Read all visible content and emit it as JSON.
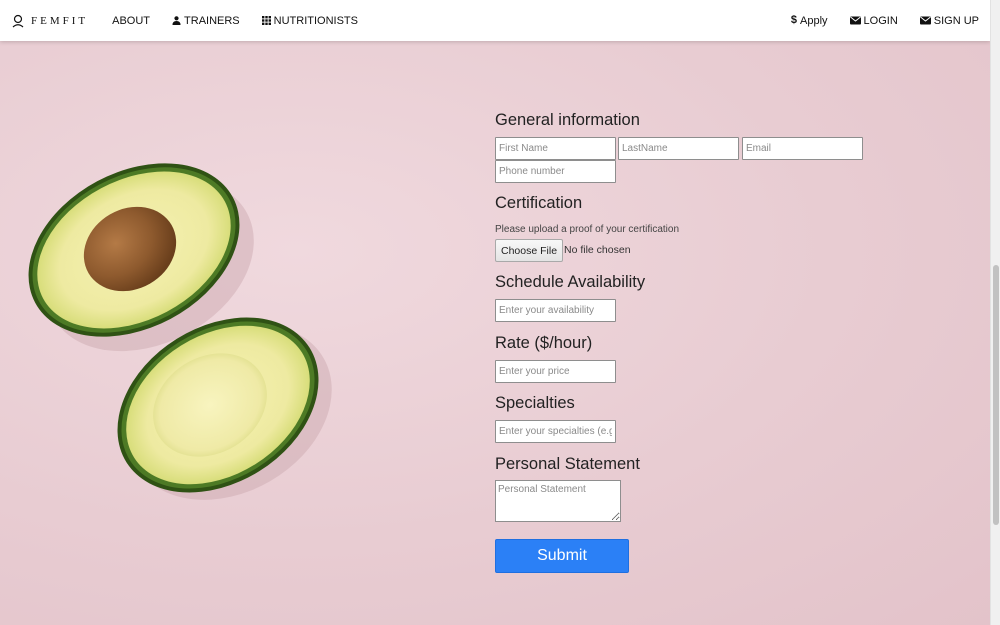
{
  "nav": {
    "brand": "FEMFIT",
    "left_links": [
      "ABOUT",
      "TRAINERS",
      "NUTRITIONISTS"
    ],
    "right_links": [
      "Apply",
      "LOGIN",
      "SIGN UP"
    ],
    "icons": {
      "logo": "user-ring-icon",
      "trainers": "user-icon",
      "nutritionists": "grid-icon",
      "apply": "dollar-icon",
      "login": "envelope-icon",
      "signup": "envelope-icon"
    }
  },
  "form": {
    "general_title": "General information",
    "first_name_placeholder": "First Name",
    "last_name_placeholder": "LastName",
    "email_placeholder": "Email",
    "phone_placeholder": "Phone number",
    "certification_title": "Certification",
    "certification_helper": "Please upload a proof of your certification",
    "choose_file_label": "Choose File",
    "file_status": "No file chosen",
    "schedule_title": "Schedule Availability",
    "schedule_placeholder": "Enter your availability",
    "rate_title": "Rate ($/hour)",
    "rate_placeholder": "Enter your price",
    "specialties_title": "Specialties",
    "specialties_placeholder": "Enter your specialties (e.g. yoga)",
    "statement_title": "Personal Statement",
    "statement_placeholder": "Personal Statement",
    "submit_label": "Submit"
  },
  "colors": {
    "background": "#e9cdd3",
    "submit": "#2b80f6",
    "avocado_skin": "#3f6b1f",
    "avocado_flesh": "#f3efaa",
    "avocado_pit": "#8e5a2e"
  }
}
